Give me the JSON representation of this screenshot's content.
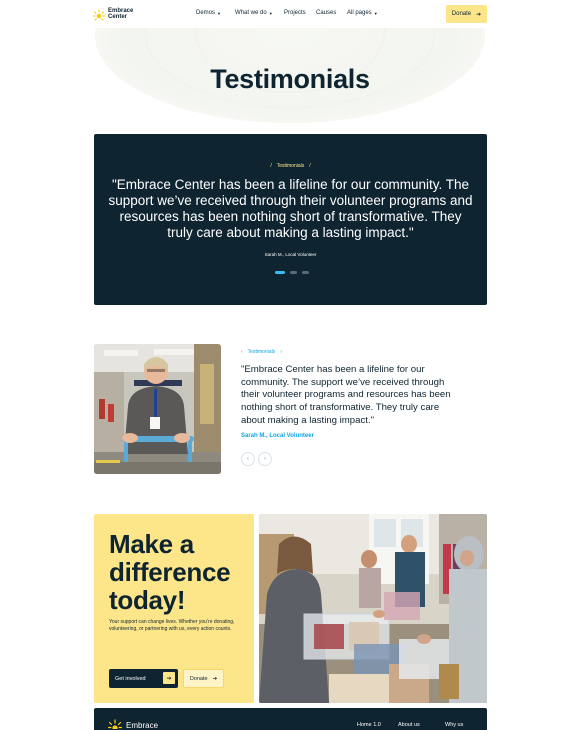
{
  "header": {
    "logo_line1": "Embrace",
    "logo_line2": "Center",
    "nav": [
      {
        "label": "Demos",
        "dropdown": true
      },
      {
        "label": "What we do",
        "dropdown": true
      },
      {
        "label": "Projects",
        "dropdown": false
      },
      {
        "label": "Causes",
        "dropdown": false
      },
      {
        "label": "All pages",
        "dropdown": true
      }
    ],
    "donate_label": "Donate"
  },
  "hero": {
    "title": "Testimonials"
  },
  "dark_testimonial": {
    "crumb": "Testimonials",
    "quote": "\"Embrace Center has been a lifeline for our community. The support we’ve received through their volunteer programs and resources has been nothing short of transformative. They truly care about making a lasting impact.\"",
    "author": "Sarah M., Local Volunteer",
    "slides_total": 3,
    "active_slide": 1
  },
  "light_testimonial": {
    "crumb": "Testimonials",
    "quote": "\"Embrace Center has been a lifeline for our community. The support we’ve received through their volunteer programs and resources has been nothing short of transformative. They truly care about making a lasting impact.\"",
    "author": "Sarah M., Local Volunteer"
  },
  "cta": {
    "title_line1": "Make a",
    "title_line2": "difference",
    "title_line3": "today!",
    "text": "Your support can change lives. Whether you’re donating, volunteering, or partnering with us, every action counts.",
    "primary_label": "Get involved",
    "secondary_label": "Donate"
  },
  "footer": {
    "logo": "Embrace",
    "links": [
      "Home 1.0",
      "About us",
      "Why us"
    ]
  },
  "colors": {
    "navy": "#0f2431",
    "yellow": "#fde68a",
    "accent_blue": "#0ea5e9"
  }
}
